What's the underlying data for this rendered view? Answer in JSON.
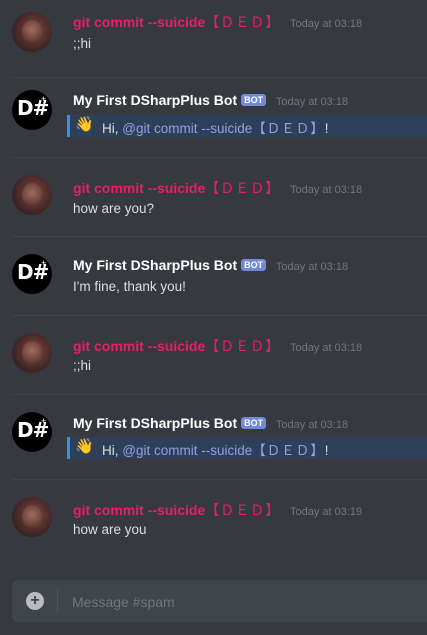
{
  "messages": [
    {
      "author": "git commit --suicide",
      "tag": "【ＤＥＤ】",
      "time": "Today at 03:18",
      "text": ";;hi"
    },
    {
      "author": "My First DSharpPlus Bot",
      "badge": "BOT",
      "time": "Today at 03:18",
      "emoji": "👋",
      "text_prefix": "Hi, ",
      "mention": "@git commit --suicide",
      "mention_tag": "【ＤＥＤ】",
      "text_suffix": "!"
    },
    {
      "author": "git commit --suicide",
      "tag": "【ＤＥＤ】",
      "time": "Today at 03:18",
      "text": "how are you?"
    },
    {
      "author": "My First DSharpPlus Bot",
      "badge": "BOT",
      "time": "Today at 03:18",
      "text": "I'm fine, thank you!"
    },
    {
      "author": "git commit --suicide",
      "tag": "【ＤＥＤ】",
      "time": "Today at 03:18",
      "text": ";;hi"
    },
    {
      "author": "My First DSharpPlus Bot",
      "badge": "BOT",
      "time": "Today at 03:18",
      "emoji": "👋",
      "text_prefix": "Hi, ",
      "mention": "@git commit --suicide",
      "mention_tag": "【ＤＥＤ】",
      "text_suffix": "!"
    },
    {
      "author": "git commit --suicide",
      "tag": "【ＤＥＤ】",
      "time": "Today at 03:19",
      "text": "how are you"
    }
  ],
  "bot_avatar": {
    "glyph": "D#",
    "mark": "+"
  },
  "composer": {
    "placeholder": "Message #spam",
    "plus": "+"
  },
  "colors": {
    "background": "#36393f",
    "user_name": "#e91e63",
    "bot_badge": "#7289da",
    "mention": "#8ea1e1",
    "embed_bar": "#3391e6"
  }
}
